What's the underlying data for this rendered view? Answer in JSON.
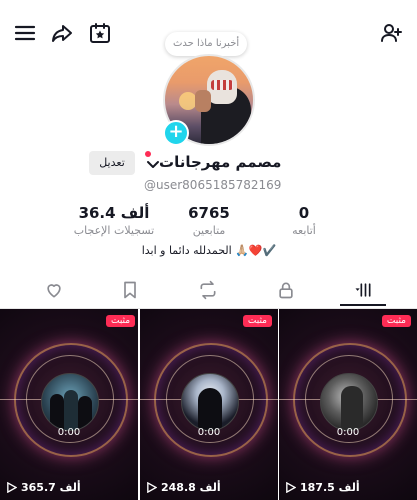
{
  "header": {
    "icons": [
      "menu-icon",
      "share-icon",
      "calendar-star-icon",
      "add-user-icon"
    ]
  },
  "profile": {
    "note_bubble": "أخبرنا ماذا حدث",
    "name": "مصمم مهرجانات",
    "edit_label": "تعديل",
    "username": "@user8065185782169",
    "bio": "الحمدلله دائما و ابدا 🙏🏼❤️✔️",
    "stats": [
      {
        "value": "0",
        "label": "أتابعه"
      },
      {
        "value": "6765",
        "label": "متابعين"
      },
      {
        "value": "36.4 ألف",
        "label": "تسجيلات الإعجاب"
      }
    ]
  },
  "tabs": {
    "items": [
      "likes-heart-icon",
      "bookmark-icon",
      "repost-icon",
      "lock-icon",
      "grid-videos-icon"
    ],
    "active": "grid-videos-icon"
  },
  "videos": [
    {
      "views": "365.7 ألف",
      "pinned": "مثبت",
      "time": "0:00"
    },
    {
      "views": "248.8 ألف",
      "pinned": "مثبت",
      "time": "0:00"
    },
    {
      "views": "187.5 ألف",
      "pinned": "مثبت",
      "time": "0:00"
    }
  ],
  "colors": {
    "accent_red": "#fe2c55",
    "add_button": "#20d5ec",
    "text_primary": "#161823",
    "text_secondary": "#8a8b91"
  }
}
